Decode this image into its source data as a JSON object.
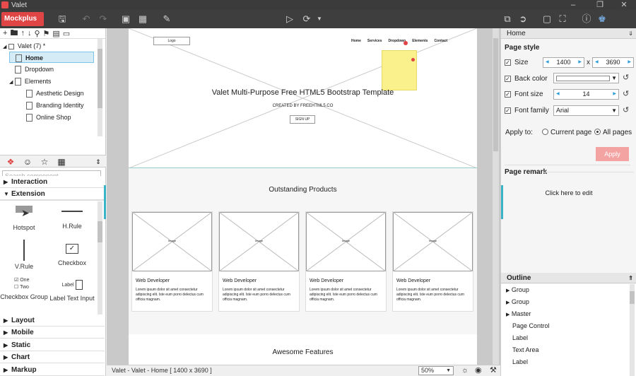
{
  "window": {
    "title": "Valet"
  },
  "toolbar": {
    "app_button": "Mockplus"
  },
  "tree": {
    "project": "Valet (7)",
    "items": [
      {
        "label": "Home",
        "selected": true
      },
      {
        "label": "Dropdown"
      },
      {
        "label": "Elements"
      },
      {
        "label": "Aesthetic Design"
      },
      {
        "label": "Branding  Identity"
      },
      {
        "label": "Online Shop"
      }
    ]
  },
  "library": {
    "search_placeholder": "Search component",
    "categories": [
      "Interaction",
      "Extension",
      "Layout",
      "Mobile",
      "Static",
      "Chart",
      "Markup"
    ],
    "components": [
      {
        "label": "Hotspot",
        "icon": "hotspot-icon"
      },
      {
        "label": "H.Rule",
        "icon": "hrule-icon"
      },
      {
        "label": "V.Rule",
        "icon": "vrule-icon"
      },
      {
        "label": "Checkbox",
        "icon": "checkbox-icon"
      },
      {
        "label": "Checkbox Group",
        "icon": "checkbox-group-icon",
        "opt1": "One",
        "opt2": "Two"
      },
      {
        "label": "Label Text Input",
        "icon": "label-input-icon",
        "mini": "Label"
      }
    ]
  },
  "canvas": {
    "logo": "Logo",
    "nav": [
      "Home",
      "Services",
      "Dropdown",
      "Elements",
      "Contact"
    ],
    "hero_title": "Valet Multi-Purpose Free HTML5 Bootstrap Template",
    "hero_sub": "CREATED BY FREEHTML5.CO",
    "hero_button": "SIGN UP",
    "products_title": "Outstanding Products",
    "image_label": "Image",
    "card_title": "Web Developer",
    "card_text": "Lorem ipsum dolor sit amet consectetur adipiscing elit. Iste eum porro delectus cum officia magnam.",
    "features_title": "Awesome Features"
  },
  "status": {
    "path": "Valet - Valet - Home [ 1400 x 3690 ]",
    "zoom": "50%"
  },
  "properties": {
    "header": "Home",
    "section": "Page style",
    "size_label": "Size",
    "width": "1400",
    "times": "x",
    "height": "3690",
    "bg_label": "Back color",
    "font_size_label": "Font size",
    "font_size": "14",
    "font_family_label": "Font family",
    "font_family": "Arial",
    "apply_to_label": "Apply to:",
    "current_page": "Current page",
    "all_pages": "All pages",
    "apply_button": "Apply",
    "remark_label": "Page remark",
    "remark_placeholder": "Click here to edit"
  },
  "outline": {
    "title": "Outline",
    "items": [
      {
        "label": "Group",
        "expandable": true
      },
      {
        "label": "Group",
        "expandable": true
      },
      {
        "label": "Master",
        "expandable": true
      },
      {
        "label": "Page Control"
      },
      {
        "label": "Label"
      },
      {
        "label": "Text Area"
      },
      {
        "label": "Label"
      }
    ]
  },
  "colors": {
    "accent": "#e04545",
    "selection": "#d5ecf7",
    "apply": "#f4a3a3",
    "teal": "#3ab3c7",
    "note": "#faf08c"
  }
}
